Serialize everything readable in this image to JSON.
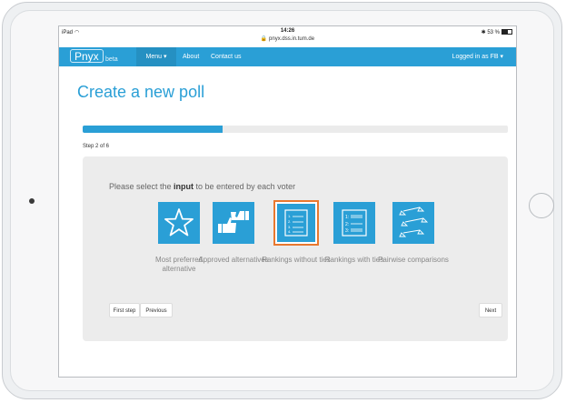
{
  "statusbar": {
    "device": "iPad",
    "time": "14:26",
    "url": "pnyx.dss.in.tum.de",
    "battery": "53 %"
  },
  "navbar": {
    "brand": "Pnyx",
    "brand_sub": "beta",
    "menu": "Menu ▾",
    "about": "About",
    "contact": "Contact us",
    "user": "Logged in as FB ▾"
  },
  "page": {
    "title": "Create a new poll",
    "progress": 0.33,
    "step": "Step 2 of 6",
    "instruction_pre": "Please select the ",
    "instruction_bold": "input",
    "instruction_post": " to be entered by each voter"
  },
  "options": [
    {
      "label": "Most preferred alternative",
      "icon": "star-icon",
      "selected": false
    },
    {
      "label": "Approved alternatives",
      "icon": "thumbs-up-down-icon",
      "selected": false
    },
    {
      "label": "Rankings without ties",
      "icon": "ranked-list-icon",
      "selected": true
    },
    {
      "label": "Rankings with ties",
      "icon": "ranked-list-ties-icon",
      "selected": false
    },
    {
      "label": "Pairwise comparisons",
      "icon": "balance-scales-icon",
      "selected": false
    }
  ],
  "buttons": {
    "first": "First step",
    "previous": "Previous",
    "next": "Next"
  },
  "colors": {
    "accent": "#2a9fd6",
    "selected_outline": "#e8782f"
  }
}
